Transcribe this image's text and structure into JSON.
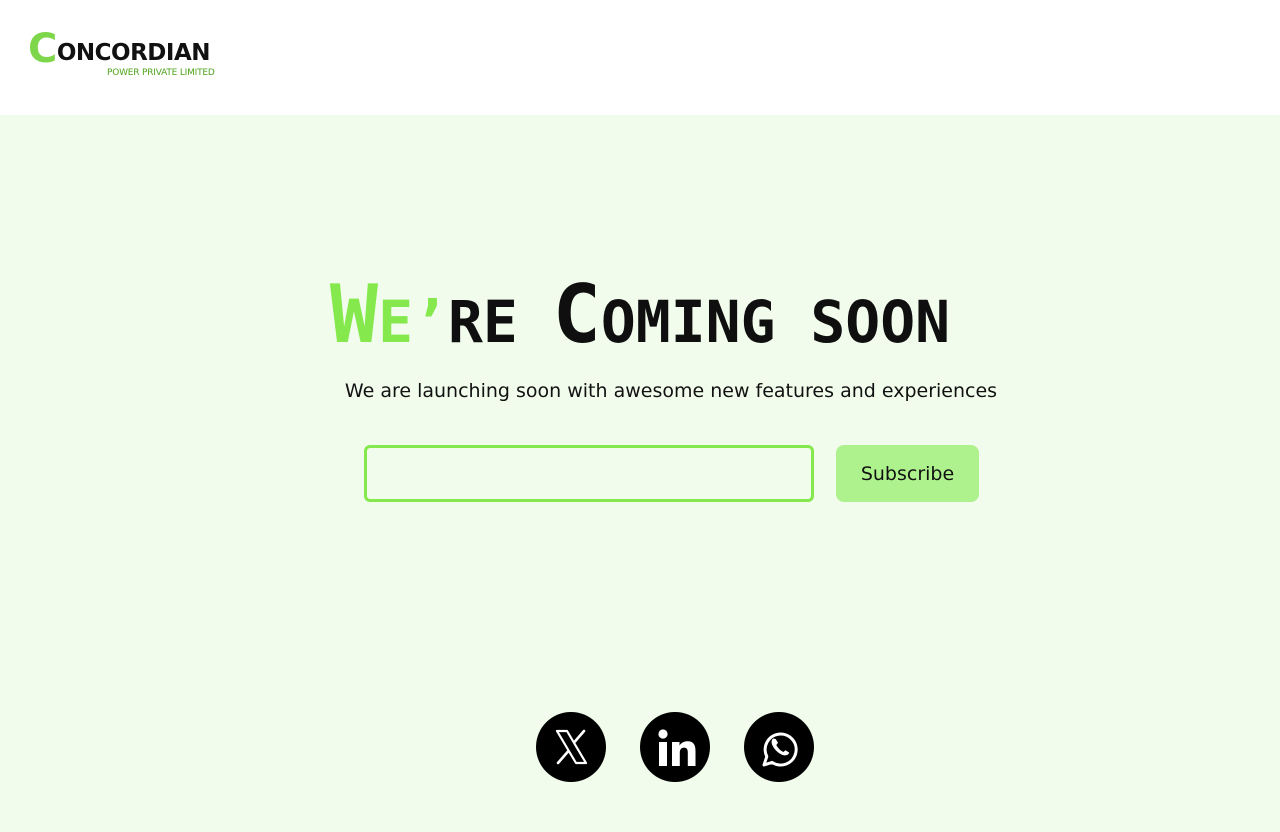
{
  "brand": {
    "logo_initial": "C",
    "logo_rest": "ONCORDIAN",
    "logo_tagline": "POWER PRIVATE LIMITED",
    "accent_color": "#85e94d",
    "background_color": "#f1fcec"
  },
  "hero": {
    "title_we_initial": "W",
    "title_we_rest": "E’",
    "title_re": "RE ",
    "title_coming_initial": "C",
    "title_coming_rest": "OMING SOON",
    "subtitle": "We are launching soon with awesome new features and experiences"
  },
  "subscribe": {
    "email_value": "",
    "email_placeholder": "",
    "button_label": "Subscribe"
  },
  "social": {
    "icons": [
      "x-icon",
      "linkedin-icon",
      "whatsapp-icon"
    ]
  }
}
